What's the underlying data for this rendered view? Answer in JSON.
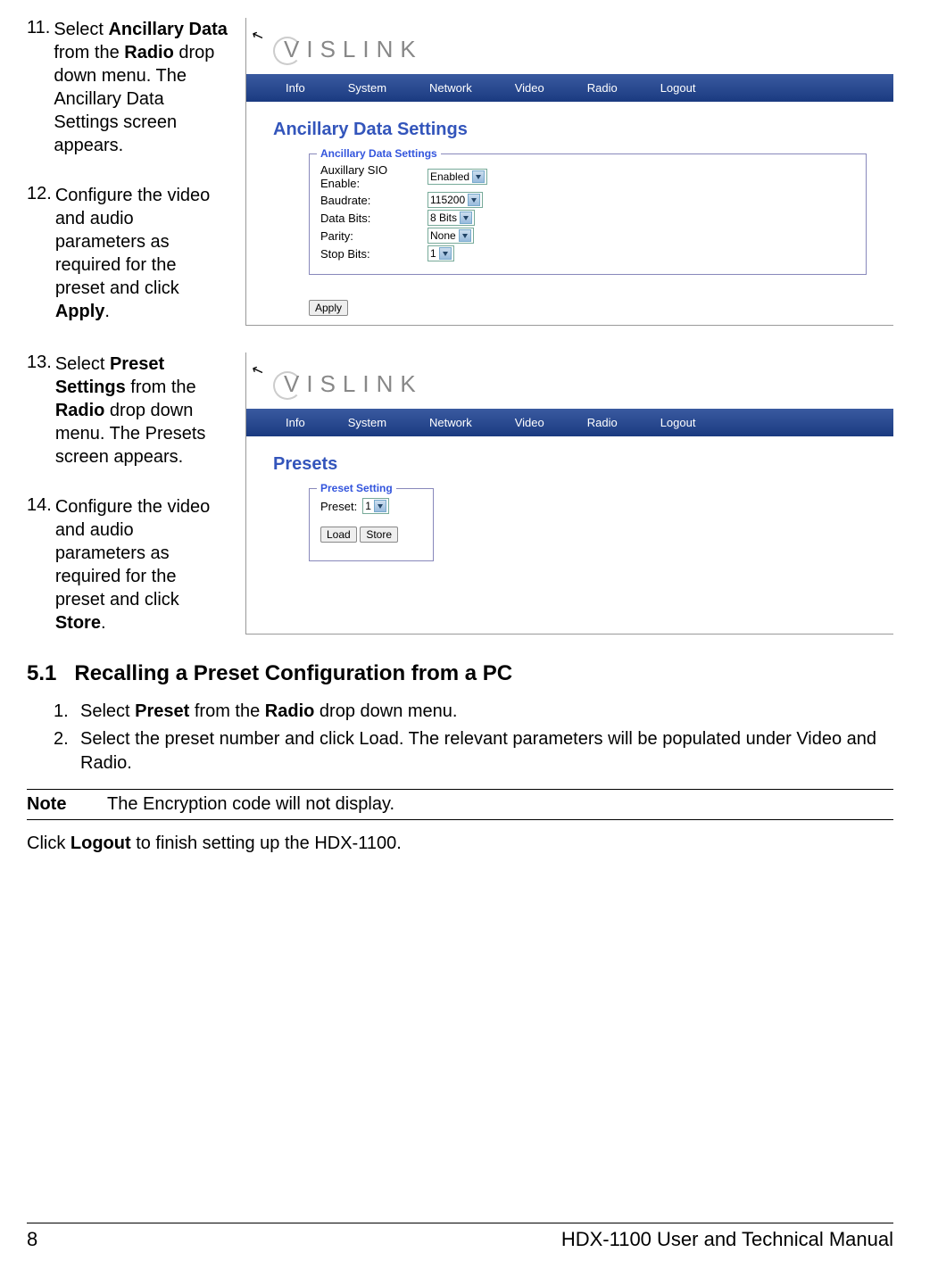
{
  "steps": {
    "s11": {
      "num": "11.",
      "t1": "Select ",
      "b1": "Ancillary Data",
      "t2": " from the ",
      "b2": "Radio",
      "t3": " drop down menu. The Ancillary Data Settings screen appears."
    },
    "s12": {
      "num": "12.",
      "t1": "Configure the video and audio parameters as required for the preset and click ",
      "b1": "Apply",
      "t2": "."
    },
    "s13": {
      "num": "13.",
      "t1": "Select ",
      "b1": "Preset Settings",
      "t2": " from the ",
      "b2": "Radio",
      "t3": " drop down menu. The Presets screen appears."
    },
    "s14": {
      "num": "14.",
      "t1": "Configure the video and audio parameters as required for the preset and click ",
      "b1": "Store",
      "t2": "."
    }
  },
  "logo": "VISLINK",
  "menu": {
    "info": "Info",
    "system": "System",
    "network": "Network",
    "video": "Video",
    "radio": "Radio",
    "logout": "Logout"
  },
  "ancillary": {
    "title": "Ancillary Data Settings",
    "legend": "Ancillary Data Settings",
    "sio_label": "Auxillary SIO Enable:",
    "sio_value": "Enabled",
    "baud_label": "Baudrate:",
    "baud_value": "115200",
    "databits_label": "Data Bits:",
    "databits_value": "8 Bits",
    "parity_label": "Parity:",
    "parity_value": "None",
    "stopbits_label": "Stop Bits:",
    "stopbits_value": "1",
    "apply": "Apply"
  },
  "presets": {
    "title": "Presets",
    "legend": "Preset Setting",
    "preset_label": "Preset:",
    "preset_value": "1",
    "load": "Load",
    "store": "Store"
  },
  "section": {
    "num": "5.1",
    "title": "Recalling a Preset Configuration from a PC",
    "i1": {
      "num": "1.",
      "t1": "Select ",
      "b1": "Preset",
      "t2": " from the ",
      "b2": "Radio",
      "t3": " drop down menu."
    },
    "i2": {
      "num": "2.",
      "t1": "Select the preset number and click Load. The relevant parameters will be populated under Video and Radio."
    }
  },
  "note": {
    "label": "Note",
    "text": "The Encryption code will not display."
  },
  "final": {
    "t1": "Click ",
    "b1": "Logout",
    "t2": " to finish setting up the HDX-1100."
  },
  "footer": {
    "page": "8",
    "doc": "HDX-1100 User and Technical Manual"
  }
}
